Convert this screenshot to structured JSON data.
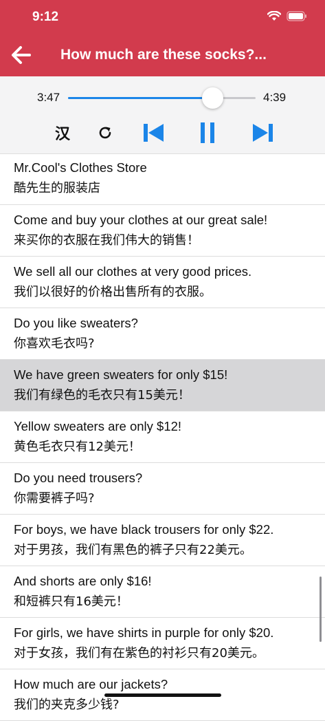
{
  "status": {
    "time": "9:12"
  },
  "header": {
    "title": "How much are these socks?...",
    "back_icon": "arrow-left-icon"
  },
  "player": {
    "current_time": "3:47",
    "total_time": "4:39",
    "progress": 0.77,
    "hanzi_toggle": "汉",
    "accent_color": "#1b85e8"
  },
  "lines": [
    {
      "en": "Mr.Cool's Clothes Store",
      "zh": "酷先生的服装店"
    },
    {
      "en": "Come and buy your clothes at our great sale!",
      "zh": "来买你的衣服在我们伟大的销售！"
    },
    {
      "en": "We sell all our clothes at very good prices.",
      "zh": "我们以很好的价格出售所有的衣服。"
    },
    {
      "en": "Do you like sweaters?",
      "zh": "你喜欢毛衣吗?"
    },
    {
      "en": "We have green sweaters for only $15!",
      "zh": "我们有绿色的毛衣只有15美元！"
    },
    {
      "en": "Yellow sweaters are only $12!",
      "zh": "黄色毛衣只有12美元！"
    },
    {
      "en": "Do you need trousers?",
      "zh": "你需要裤子吗?"
    },
    {
      "en": "For boys, we have black trousers for only $22.",
      "zh": "对于男孩，我们有黑色的裤子只有22美元。"
    },
    {
      "en": "And shorts are only $16!",
      "zh": "和短裤只有16美元！"
    },
    {
      "en": "For girls, we have shirts in purple for only $20.",
      "zh": "对于女孩，我们有在紫色的衬衫只有20美元。"
    },
    {
      "en": "How much are our jackets?",
      "zh": "我们的夹克多少钱?"
    }
  ],
  "highlighted_index": 4
}
